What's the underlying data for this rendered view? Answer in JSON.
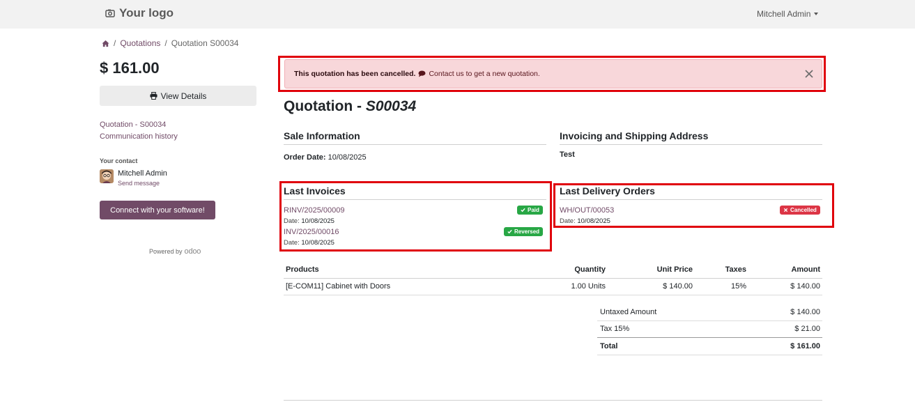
{
  "navbar": {
    "logo_text": "Your logo",
    "user_name": "Mitchell Admin"
  },
  "breadcrumb": {
    "items": [
      "Quotations",
      "Quotation S00034"
    ]
  },
  "sidebar": {
    "amount": "$ 161.00",
    "view_details_label": "View Details",
    "links": [
      "Quotation - S00034",
      "Communication history"
    ],
    "contact_label": "Your contact",
    "contact_name": "Mitchell Admin",
    "send_message_label": "Send message",
    "connect_label": "Connect with your software!",
    "powered_by": "Powered by",
    "powered_brand": "odoo"
  },
  "alert": {
    "strong_text": "This quotation has been cancelled.",
    "link_text": "Contact us to get a new quotation."
  },
  "document": {
    "title_prefix": "Quotation - ",
    "title_number": "S00034"
  },
  "sale_info": {
    "heading": "Sale Information",
    "order_date_label": "Order Date:",
    "order_date": "10/08/2025"
  },
  "address": {
    "heading": "Invoicing and Shipping Address",
    "name": "Test"
  },
  "invoices": {
    "heading": "Last Invoices",
    "date_label": "Date:",
    "items": [
      {
        "number": "RINV/2025/00009",
        "date": "10/08/2025",
        "status": "Paid"
      },
      {
        "number": "INV/2025/00016",
        "date": "10/08/2025",
        "status": "Reversed"
      }
    ]
  },
  "deliveries": {
    "heading": "Last Delivery Orders",
    "date_label": "Date:",
    "items": [
      {
        "number": "WH/OUT/00053",
        "date": "10/08/2025",
        "status": "Cancelled"
      }
    ]
  },
  "lines_table": {
    "headers": [
      "Products",
      "Quantity",
      "Unit Price",
      "Taxes",
      "Amount"
    ],
    "rows": [
      {
        "product": "[E-COM11] Cabinet with Doors",
        "quantity": "1.00 Units",
        "unit_price": "$ 140.00",
        "taxes": "15%",
        "amount": "$ 140.00"
      }
    ]
  },
  "totals": {
    "untaxed_label": "Untaxed Amount",
    "untaxed_value": "$ 140.00",
    "tax_label": "Tax 15%",
    "tax_value": "$ 21.00",
    "total_label": "Total",
    "total_value": "$ 161.00"
  },
  "colors": {
    "brand": "#714b67",
    "alert_bg": "#f8d7da",
    "highlight": "#e0000b",
    "badge_green": "#28a745",
    "badge_red": "#dc3545"
  },
  "icons": [
    "camera-icon",
    "caret-down-icon",
    "home-icon",
    "printer-icon",
    "avatar",
    "chat-icon",
    "close-icon",
    "check-icon",
    "times-icon"
  ]
}
